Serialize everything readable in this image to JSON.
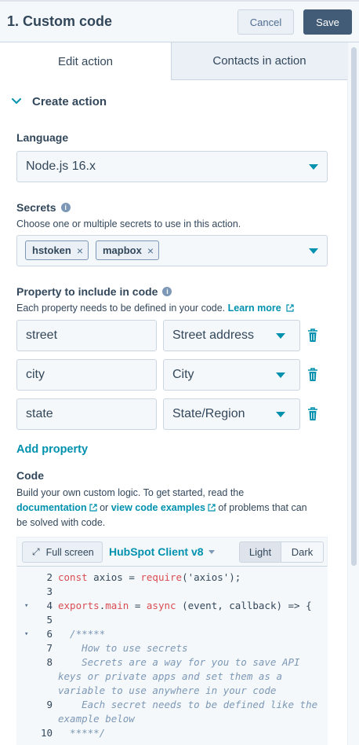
{
  "header": {
    "title": "1. Custom code",
    "cancel_label": "Cancel",
    "save_label": "Save"
  },
  "tabs": [
    {
      "label": "Edit action",
      "active": true
    },
    {
      "label": "Contacts in action",
      "active": false
    }
  ],
  "section": {
    "label": "Create action",
    "icon": "chevron-down-icon"
  },
  "language": {
    "label": "Language",
    "value": "Node.js 16.x"
  },
  "secrets": {
    "label": "Secrets",
    "help": "Choose one or multiple secrets to use in this action.",
    "tags": [
      "hstoken",
      "mapbox"
    ],
    "remove_glyph": "×"
  },
  "properties": {
    "label": "Property to include in code",
    "help_prefix": "Each property needs to be defined in your code.",
    "learn_more": "Learn more",
    "rows": [
      {
        "name": "street",
        "property": "Street address"
      },
      {
        "name": "city",
        "property": "City"
      },
      {
        "name": "state",
        "property": "State/Region"
      }
    ],
    "add_label": "Add property"
  },
  "code": {
    "label": "Code",
    "help_line1": "Build your own custom logic. To get started, read the",
    "documentation": "documentation",
    "or": "or",
    "view_examples": "view code examples",
    "help_line2_suffix": "of problems that can",
    "help_line3": "be solved with code.",
    "fullscreen_label": "Full screen",
    "client_label": "HubSpot Client v8",
    "theme_light": "Light",
    "theme_dark": "Dark",
    "lines": [
      {
        "n": "2",
        "parts": [
          [
            "kw",
            "const"
          ],
          [
            "fn",
            " axios = "
          ],
          [
            "kw",
            "require"
          ],
          [
            "fn",
            "('axios');"
          ]
        ]
      },
      {
        "n": "3",
        "parts": []
      },
      {
        "n": "4",
        "fold": true,
        "parts": [
          [
            "kw",
            "exports"
          ],
          [
            "fn",
            "."
          ],
          [
            "kw",
            "main"
          ],
          [
            "fn",
            " = "
          ],
          [
            "kw",
            "async"
          ],
          [
            "fn",
            " (event, callback) => {"
          ]
        ]
      },
      {
        "n": "5",
        "parts": []
      },
      {
        "n": "6",
        "fold": true,
        "parts": [
          [
            "cm",
            "  /*****"
          ]
        ]
      },
      {
        "n": "7",
        "parts": [
          [
            "cm",
            "    How to use secrets"
          ]
        ]
      },
      {
        "n": "8",
        "parts": [
          [
            "cm",
            "    Secrets are a way for you to save API keys or private apps and set them as a variable to use anywhere in your code"
          ]
        ]
      },
      {
        "n": "9",
        "parts": [
          [
            "cm",
            "    Each secret needs to be defined like the example below"
          ]
        ]
      },
      {
        "n": "10",
        "parts": [
          [
            "cm",
            "  *****/"
          ]
        ]
      }
    ]
  },
  "colors": {
    "accent": "#0091ae",
    "primary_button": "#425b76",
    "text": "#33475b",
    "keyword": "#d94c53",
    "comment": "#7c98b6"
  }
}
